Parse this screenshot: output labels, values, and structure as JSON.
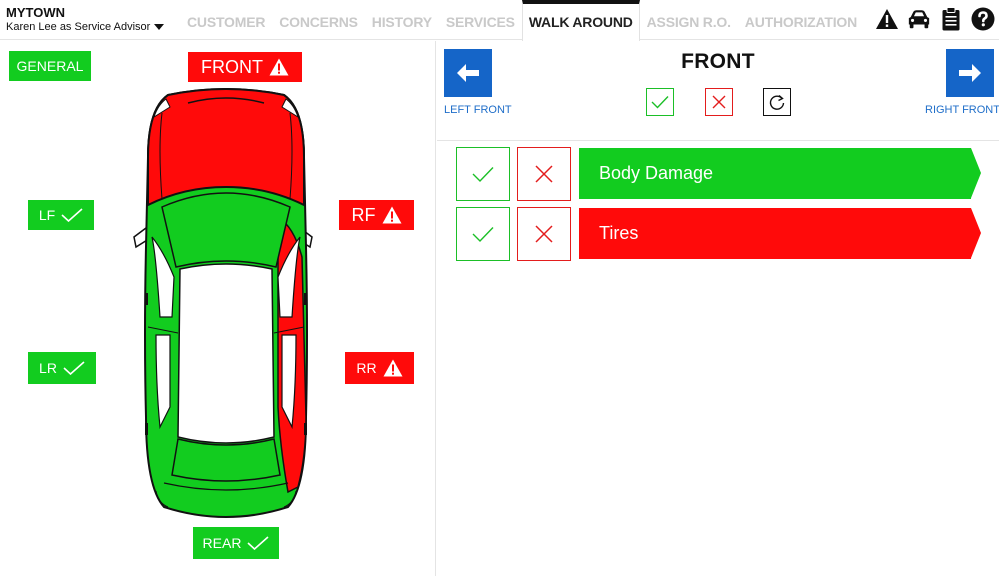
{
  "app": {
    "store": "MYTOWN",
    "user": "Karen Lee as Service Advisor"
  },
  "tabs": [
    {
      "label": "CUSTOMER",
      "active": false
    },
    {
      "label": "CONCERNS",
      "active": false
    },
    {
      "label": "HISTORY",
      "active": false
    },
    {
      "label": "SERVICES",
      "active": false
    },
    {
      "label": "WALK AROUND",
      "active": true
    },
    {
      "label": "ASSIGN R.O.",
      "active": false
    },
    {
      "label": "AUTHORIZATION",
      "active": false
    }
  ],
  "header_icons": [
    "warning-icon",
    "car-icon",
    "clipboard-icon",
    "help-icon"
  ],
  "zones": {
    "general": {
      "label": "GENERAL",
      "status": "ok"
    },
    "front": {
      "label": "FRONT",
      "status": "warning"
    },
    "lf": {
      "label": "LF",
      "status": "ok"
    },
    "rf": {
      "label": "RF",
      "status": "warning"
    },
    "lr": {
      "label": "LR",
      "status": "ok"
    },
    "rr": {
      "label": "RR",
      "status": "warning"
    },
    "rear": {
      "label": "REAR",
      "status": "ok"
    }
  },
  "section": {
    "title": "FRONT",
    "prev_label": "LEFT FRONT",
    "next_label": "RIGHT FRONT"
  },
  "items": [
    {
      "label": "Body Damage",
      "status": "ok"
    },
    {
      "label": "Tires",
      "status": "fail"
    }
  ],
  "colors": {
    "ok": "#12cc1f",
    "bad": "#ff0a0a",
    "nav": "#1565c8",
    "link": "#1f6ec9"
  }
}
